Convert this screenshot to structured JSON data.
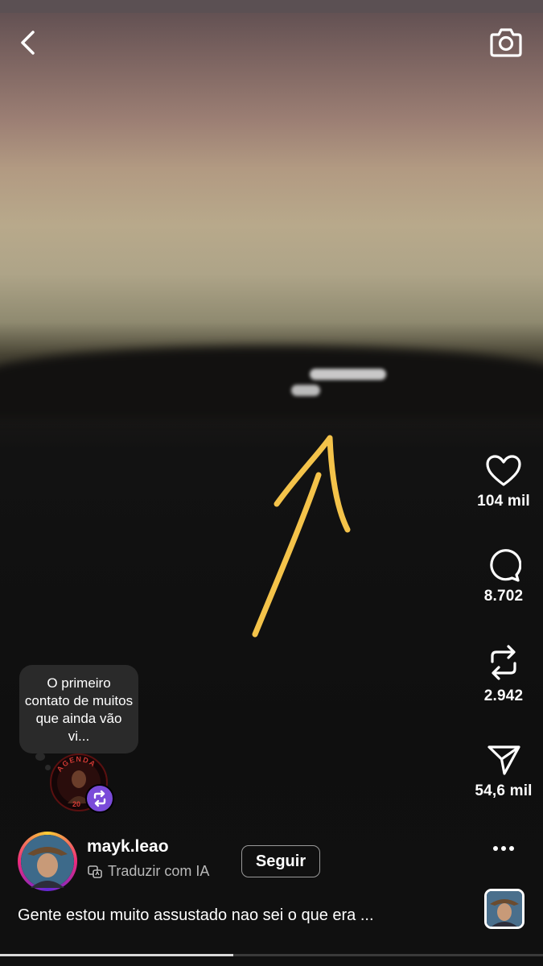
{
  "icons": {
    "back": "chevron-left-icon",
    "camera": "camera-icon",
    "like": "heart-icon",
    "comment": "comment-icon",
    "repost": "repost-icon",
    "share": "send-icon",
    "more": "more-dots-icon",
    "translate": "translate-icon"
  },
  "actions": {
    "likes": "104 mil",
    "comments": "8.702",
    "reposts": "2.942",
    "shares": "54,6 mil"
  },
  "note_bubble": {
    "text": "O primeiro contato de muitos que ainda vão vi..."
  },
  "music_avatar": {
    "text": "AGENDA 20"
  },
  "post": {
    "username": "mayk.leao",
    "translate_label": "Traduzir com IA",
    "follow_label": "Seguir",
    "caption": "Gente estou muito assustado nao sei o que era ..."
  },
  "colors": {
    "arrow": "#f4c34a",
    "accent_badge": "#7a4bd9"
  },
  "playback": {
    "progress": 0.43
  }
}
